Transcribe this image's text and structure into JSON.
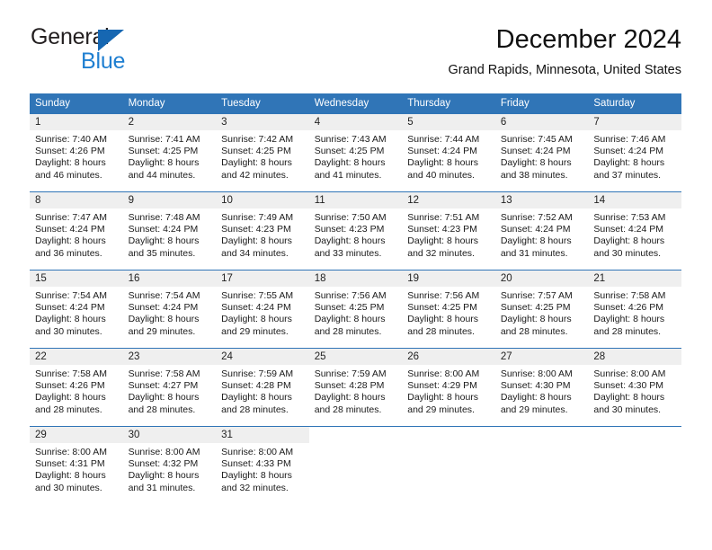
{
  "brand": {
    "name_part1": "General",
    "name_part2": "Blue",
    "logo_icon": "triangle-logo-icon",
    "color_dark": "#231f20",
    "color_blue": "#1f7fd1",
    "color_triangle": "#1667b2"
  },
  "header": {
    "title": "December 2024",
    "subtitle": "Grand Rapids, Minnesota, United States"
  },
  "theme": {
    "header_row_bg": "#3075b7",
    "daynum_strip_bg": "#efefef",
    "border_color": "#3075b7",
    "text_color": "#1a1a1a"
  },
  "calendar": {
    "weekday_headers": [
      "Sunday",
      "Monday",
      "Tuesday",
      "Wednesday",
      "Thursday",
      "Friday",
      "Saturday"
    ],
    "weeks": [
      [
        {
          "day": "1",
          "sunrise": "Sunrise: 7:40 AM",
          "sunset": "Sunset: 4:26 PM",
          "daylight_line1": "Daylight: 8 hours",
          "daylight_line2": "and 46 minutes."
        },
        {
          "day": "2",
          "sunrise": "Sunrise: 7:41 AM",
          "sunset": "Sunset: 4:25 PM",
          "daylight_line1": "Daylight: 8 hours",
          "daylight_line2": "and 44 minutes."
        },
        {
          "day": "3",
          "sunrise": "Sunrise: 7:42 AM",
          "sunset": "Sunset: 4:25 PM",
          "daylight_line1": "Daylight: 8 hours",
          "daylight_line2": "and 42 minutes."
        },
        {
          "day": "4",
          "sunrise": "Sunrise: 7:43 AM",
          "sunset": "Sunset: 4:25 PM",
          "daylight_line1": "Daylight: 8 hours",
          "daylight_line2": "and 41 minutes."
        },
        {
          "day": "5",
          "sunrise": "Sunrise: 7:44 AM",
          "sunset": "Sunset: 4:24 PM",
          "daylight_line1": "Daylight: 8 hours",
          "daylight_line2": "and 40 minutes."
        },
        {
          "day": "6",
          "sunrise": "Sunrise: 7:45 AM",
          "sunset": "Sunset: 4:24 PM",
          "daylight_line1": "Daylight: 8 hours",
          "daylight_line2": "and 38 minutes."
        },
        {
          "day": "7",
          "sunrise": "Sunrise: 7:46 AM",
          "sunset": "Sunset: 4:24 PM",
          "daylight_line1": "Daylight: 8 hours",
          "daylight_line2": "and 37 minutes."
        }
      ],
      [
        {
          "day": "8",
          "sunrise": "Sunrise: 7:47 AM",
          "sunset": "Sunset: 4:24 PM",
          "daylight_line1": "Daylight: 8 hours",
          "daylight_line2": "and 36 minutes."
        },
        {
          "day": "9",
          "sunrise": "Sunrise: 7:48 AM",
          "sunset": "Sunset: 4:24 PM",
          "daylight_line1": "Daylight: 8 hours",
          "daylight_line2": "and 35 minutes."
        },
        {
          "day": "10",
          "sunrise": "Sunrise: 7:49 AM",
          "sunset": "Sunset: 4:23 PM",
          "daylight_line1": "Daylight: 8 hours",
          "daylight_line2": "and 34 minutes."
        },
        {
          "day": "11",
          "sunrise": "Sunrise: 7:50 AM",
          "sunset": "Sunset: 4:23 PM",
          "daylight_line1": "Daylight: 8 hours",
          "daylight_line2": "and 33 minutes."
        },
        {
          "day": "12",
          "sunrise": "Sunrise: 7:51 AM",
          "sunset": "Sunset: 4:23 PM",
          "daylight_line1": "Daylight: 8 hours",
          "daylight_line2": "and 32 minutes."
        },
        {
          "day": "13",
          "sunrise": "Sunrise: 7:52 AM",
          "sunset": "Sunset: 4:24 PM",
          "daylight_line1": "Daylight: 8 hours",
          "daylight_line2": "and 31 minutes."
        },
        {
          "day": "14",
          "sunrise": "Sunrise: 7:53 AM",
          "sunset": "Sunset: 4:24 PM",
          "daylight_line1": "Daylight: 8 hours",
          "daylight_line2": "and 30 minutes."
        }
      ],
      [
        {
          "day": "15",
          "sunrise": "Sunrise: 7:54 AM",
          "sunset": "Sunset: 4:24 PM",
          "daylight_line1": "Daylight: 8 hours",
          "daylight_line2": "and 30 minutes."
        },
        {
          "day": "16",
          "sunrise": "Sunrise: 7:54 AM",
          "sunset": "Sunset: 4:24 PM",
          "daylight_line1": "Daylight: 8 hours",
          "daylight_line2": "and 29 minutes."
        },
        {
          "day": "17",
          "sunrise": "Sunrise: 7:55 AM",
          "sunset": "Sunset: 4:24 PM",
          "daylight_line1": "Daylight: 8 hours",
          "daylight_line2": "and 29 minutes."
        },
        {
          "day": "18",
          "sunrise": "Sunrise: 7:56 AM",
          "sunset": "Sunset: 4:25 PM",
          "daylight_line1": "Daylight: 8 hours",
          "daylight_line2": "and 28 minutes."
        },
        {
          "day": "19",
          "sunrise": "Sunrise: 7:56 AM",
          "sunset": "Sunset: 4:25 PM",
          "daylight_line1": "Daylight: 8 hours",
          "daylight_line2": "and 28 minutes."
        },
        {
          "day": "20",
          "sunrise": "Sunrise: 7:57 AM",
          "sunset": "Sunset: 4:25 PM",
          "daylight_line1": "Daylight: 8 hours",
          "daylight_line2": "and 28 minutes."
        },
        {
          "day": "21",
          "sunrise": "Sunrise: 7:58 AM",
          "sunset": "Sunset: 4:26 PM",
          "daylight_line1": "Daylight: 8 hours",
          "daylight_line2": "and 28 minutes."
        }
      ],
      [
        {
          "day": "22",
          "sunrise": "Sunrise: 7:58 AM",
          "sunset": "Sunset: 4:26 PM",
          "daylight_line1": "Daylight: 8 hours",
          "daylight_line2": "and 28 minutes."
        },
        {
          "day": "23",
          "sunrise": "Sunrise: 7:58 AM",
          "sunset": "Sunset: 4:27 PM",
          "daylight_line1": "Daylight: 8 hours",
          "daylight_line2": "and 28 minutes."
        },
        {
          "day": "24",
          "sunrise": "Sunrise: 7:59 AM",
          "sunset": "Sunset: 4:28 PM",
          "daylight_line1": "Daylight: 8 hours",
          "daylight_line2": "and 28 minutes."
        },
        {
          "day": "25",
          "sunrise": "Sunrise: 7:59 AM",
          "sunset": "Sunset: 4:28 PM",
          "daylight_line1": "Daylight: 8 hours",
          "daylight_line2": "and 28 minutes."
        },
        {
          "day": "26",
          "sunrise": "Sunrise: 8:00 AM",
          "sunset": "Sunset: 4:29 PM",
          "daylight_line1": "Daylight: 8 hours",
          "daylight_line2": "and 29 minutes."
        },
        {
          "day": "27",
          "sunrise": "Sunrise: 8:00 AM",
          "sunset": "Sunset: 4:30 PM",
          "daylight_line1": "Daylight: 8 hours",
          "daylight_line2": "and 29 minutes."
        },
        {
          "day": "28",
          "sunrise": "Sunrise: 8:00 AM",
          "sunset": "Sunset: 4:30 PM",
          "daylight_line1": "Daylight: 8 hours",
          "daylight_line2": "and 30 minutes."
        }
      ],
      [
        {
          "day": "29",
          "sunrise": "Sunrise: 8:00 AM",
          "sunset": "Sunset: 4:31 PM",
          "daylight_line1": "Daylight: 8 hours",
          "daylight_line2": "and 30 minutes."
        },
        {
          "day": "30",
          "sunrise": "Sunrise: 8:00 AM",
          "sunset": "Sunset: 4:32 PM",
          "daylight_line1": "Daylight: 8 hours",
          "daylight_line2": "and 31 minutes."
        },
        {
          "day": "31",
          "sunrise": "Sunrise: 8:00 AM",
          "sunset": "Sunset: 4:33 PM",
          "daylight_line1": "Daylight: 8 hours",
          "daylight_line2": "and 32 minutes."
        },
        {
          "day": "",
          "sunrise": "",
          "sunset": "",
          "daylight_line1": "",
          "daylight_line2": ""
        },
        {
          "day": "",
          "sunrise": "",
          "sunset": "",
          "daylight_line1": "",
          "daylight_line2": ""
        },
        {
          "day": "",
          "sunrise": "",
          "sunset": "",
          "daylight_line1": "",
          "daylight_line2": ""
        },
        {
          "day": "",
          "sunrise": "",
          "sunset": "",
          "daylight_line1": "",
          "daylight_line2": ""
        }
      ]
    ]
  }
}
